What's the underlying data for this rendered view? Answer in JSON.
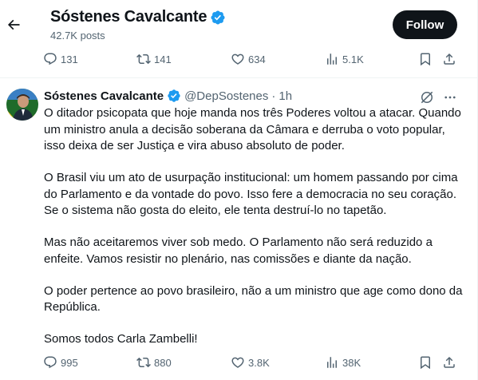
{
  "header": {
    "name": "Sóstenes Cavalcante",
    "post_count": "42.7K posts",
    "follow_label": "Follow"
  },
  "top_actions": {
    "replies": "131",
    "reposts": "141",
    "likes": "634",
    "views": "5.1K"
  },
  "post": {
    "author": "Sóstenes Cavalcante",
    "handle": "@DepSostenes",
    "separator": "·",
    "time": "1h",
    "paragraphs": [
      "O ditador psicopata que hoje manda nos três Poderes voltou a atacar. Quando um ministro anula a decisão soberana da Câmara e derruba o voto popular, isso deixa de ser Justiça e vira abuso absoluto de poder.",
      "O Brasil viu um ato de usurpação institucional: um homem passando por cima do Parlamento e da vontade do povo. Isso fere a democracia no seu coração. Se o sistema não gosta do eleito, ele tenta destruí-lo no tapetão.",
      "Mas não aceitaremos viver sob medo. O Parlamento não será reduzido a enfeite. Vamos resistir no plenário, nas comissões e diante da nação.",
      "O poder pertence ao povo brasileiro, não a um ministro que age como dono da República.",
      "Somos todos Carla Zambelli!"
    ],
    "actions": {
      "replies": "995",
      "reposts": "880",
      "likes": "3.8K",
      "views": "38K"
    }
  },
  "colors": {
    "verified_blue": "#1d9bf0",
    "text_primary": "#0f1419",
    "text_secondary": "#536471",
    "follow_bg": "#0f1419"
  }
}
